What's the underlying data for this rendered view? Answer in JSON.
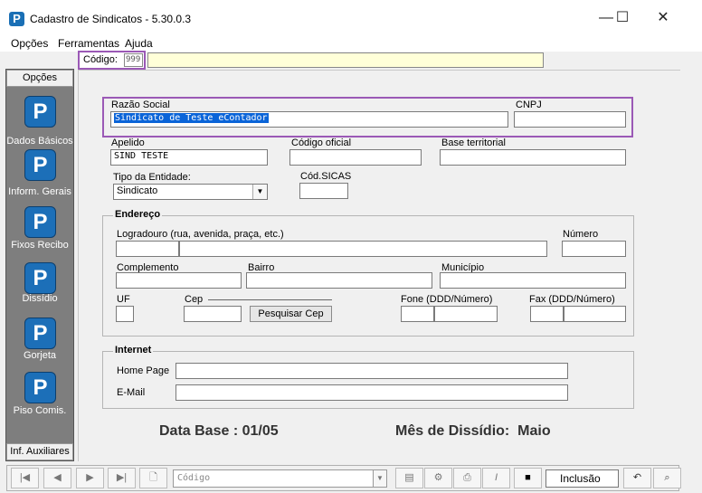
{
  "window": {
    "title": "Cadastro de Sindicatos - 5.30.0.3",
    "app_icon_letter": "P",
    "minimize_glyph": "—",
    "maximize_glyph": "☐",
    "close_glyph": "✕"
  },
  "menu": [
    "Opções",
    "Ferramentas",
    "Ajuda"
  ],
  "codigo": {
    "label": "Código:",
    "value": "999"
  },
  "sidebar": {
    "header": "Opções",
    "footer": "Inf. Auxiliares",
    "items": [
      {
        "label": "Dados Básicos",
        "icon": "P"
      },
      {
        "label": "Inform. Gerais",
        "icon": "P"
      },
      {
        "label": "Fixos Recibo",
        "icon": "P"
      },
      {
        "label": "Dissídio",
        "icon": "P"
      },
      {
        "label": "Gorjeta",
        "icon": "P"
      },
      {
        "label": "Piso Comis.",
        "icon": "P"
      }
    ]
  },
  "form": {
    "razao_social": {
      "label": "Razão Social",
      "value": "Sindicato de Teste eContador"
    },
    "cnpj": {
      "label": "CNPJ",
      "value": ""
    },
    "apelido": {
      "label": "Apelido",
      "value": "SIND TESTE"
    },
    "codigo_oficial": {
      "label": "Código oficial",
      "value": ""
    },
    "base_territorial": {
      "label": "Base territorial",
      "value": ""
    },
    "tipo_entidade": {
      "label": "Tipo da Entidade:",
      "value": "Sindicato"
    },
    "cod_sicas": {
      "label": "Cód.SICAS",
      "value": ""
    }
  },
  "endereco": {
    "title": "Endereço",
    "logradouro_label": "Logradouro (rua, avenida, praça, etc.)",
    "numero_label": "Número",
    "complemento_label": "Complemento",
    "bairro_label": "Bairro",
    "municipio_label": "Município",
    "uf_label": "UF",
    "cep_label": "Cep",
    "pesquisar_cep": "Pesquisar Cep",
    "fone_label": "Fone (DDD/Número)",
    "fax_label": "Fax (DDD/Número)"
  },
  "internet": {
    "title": "Internet",
    "home_page_label": "Home Page",
    "email_label": "E-Mail"
  },
  "data_base": "Data Base : 01/05",
  "mes_dissidio": "Mês de Dissídio:  Maio",
  "toolbar": {
    "first": "|◀",
    "prev": "◀",
    "next": "▶",
    "last": "▶|",
    "new_glyph": "🗋",
    "combo_placeholder": "Código",
    "status": "Inclusão",
    "save_glyph": "💾",
    "undo_glyph": "↶",
    "find_glyph": "🔭"
  }
}
